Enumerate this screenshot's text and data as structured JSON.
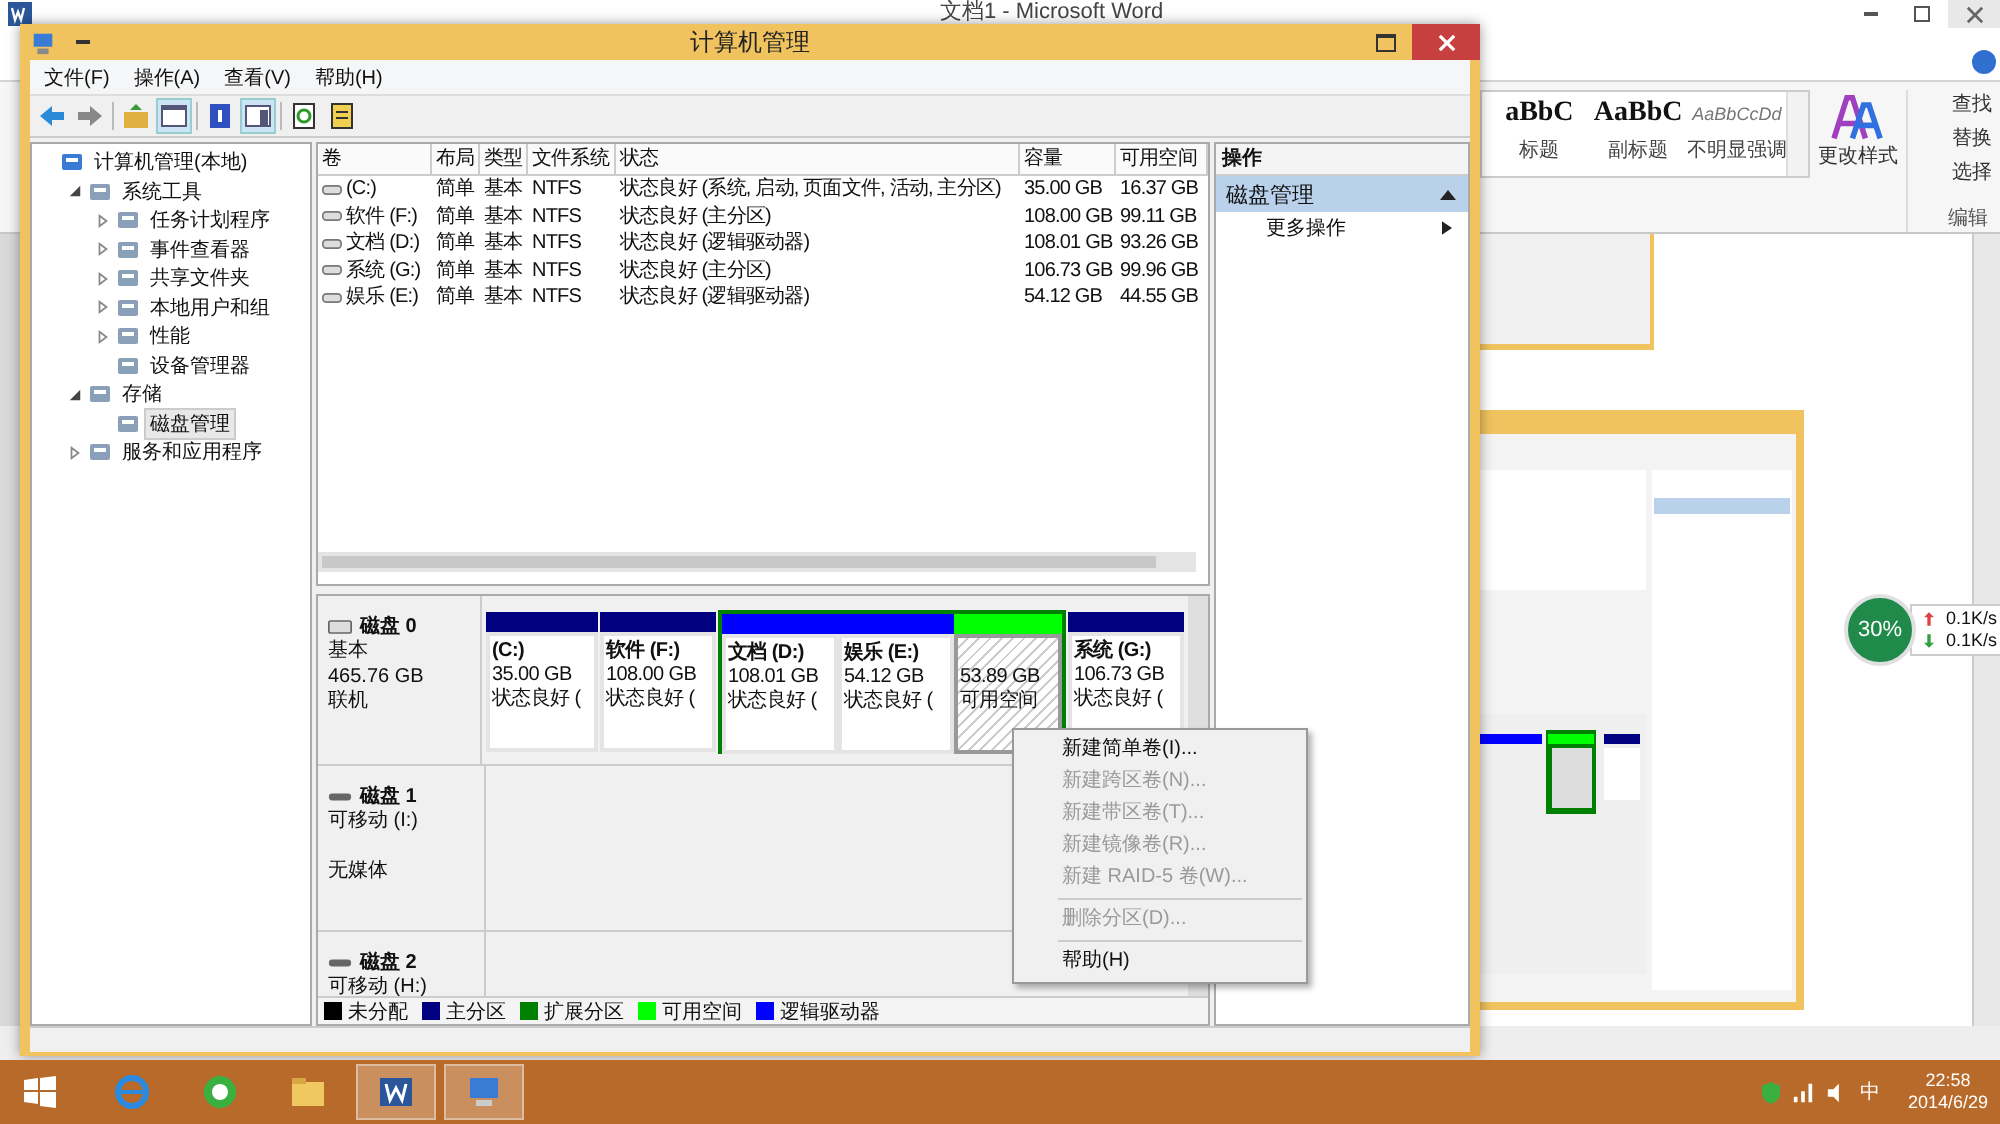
{
  "word": {
    "title": "文档1 - Microsoft Word",
    "styles": [
      {
        "sample": "aBbC",
        "label": "标题",
        "kind": "heading"
      },
      {
        "sample": "AaBbC",
        "label": "副标题",
        "kind": "heading"
      },
      {
        "sample": "AaBbCcDd",
        "label": "不明显强调",
        "kind": "emphasis"
      }
    ],
    "change_styles": "更改样式",
    "edit_buttons": [
      "查找",
      "替换",
      "选择"
    ],
    "edit_group": "编辑"
  },
  "window": {
    "title": "计算机管理"
  },
  "menu": [
    "文件(F)",
    "操作(A)",
    "查看(V)",
    "帮助(H)"
  ],
  "tree": [
    {
      "label": "计算机管理(本地)",
      "selected": false,
      "children": [
        {
          "label": "系统工具",
          "expanded": true,
          "selected": false,
          "children": [
            {
              "label": "任务计划程序",
              "expanded": false,
              "selected": false
            },
            {
              "label": "事件查看器",
              "expanded": false,
              "selected": false
            },
            {
              "label": "共享文件夹",
              "expanded": false,
              "selected": false
            },
            {
              "label": "本地用户和组",
              "expanded": false,
              "selected": false
            },
            {
              "label": "性能",
              "expanded": false,
              "selected": false
            },
            {
              "label": "设备管理器",
              "selected": false
            }
          ]
        },
        {
          "label": "存储",
          "expanded": true,
          "selected": false,
          "children": [
            {
              "label": "磁盘管理",
              "selected": true
            }
          ]
        },
        {
          "label": "服务和应用程序",
          "expanded": false,
          "selected": false
        }
      ]
    }
  ],
  "volumes": {
    "columns": [
      "卷",
      "布局",
      "类型",
      "文件系统",
      "状态",
      "容量",
      "可用空间"
    ],
    "rows": [
      [
        "(C:)",
        "简单",
        "基本",
        "NTFS",
        "状态良好 (系统, 启动, 页面文件, 活动, 主分区)",
        "35.00 GB",
        "16.37 GB"
      ],
      [
        "软件 (F:)",
        "简单",
        "基本",
        "NTFS",
        "状态良好 (主分区)",
        "108.00 GB",
        "99.11 GB"
      ],
      [
        "文档 (D:)",
        "简单",
        "基本",
        "NTFS",
        "状态良好 (逻辑驱动器)",
        "108.01 GB",
        "93.26 GB"
      ],
      [
        "系统 (G:)",
        "简单",
        "基本",
        "NTFS",
        "状态良好 (主分区)",
        "106.73 GB",
        "99.96 GB"
      ],
      [
        "娱乐 (E:)",
        "简单",
        "基本",
        "NTFS",
        "状态良好 (逻辑驱动器)",
        "54.12 GB",
        "44.55 GB"
      ]
    ]
  },
  "disks": [
    {
      "name": "磁盘 0",
      "kind": "fixed",
      "lines": [
        "基本",
        "465.76 GB",
        "联机"
      ],
      "partitions": [
        {
          "kind": "primary",
          "label": "(C:)",
          "size": "35.00 GB",
          "status": "状态良好 (",
          "selected": false
        },
        {
          "kind": "primary",
          "label": "软件  (F:)",
          "size": "108.00 GB",
          "status": "状态良好 (",
          "selected": false
        },
        {
          "kind": "extended",
          "children": [
            {
              "kind": "logical",
              "label": "文档  (D:)",
              "size": "108.01 GB",
              "status": "状态良好 (",
              "selected": false
            },
            {
              "kind": "logical",
              "label": "娱乐  (E:)",
              "size": "54.12 GB",
              "status": "状态良好 (",
              "selected": false
            },
            {
              "kind": "free",
              "size": "53.89 GB",
              "status": "可用空间",
              "selected": true
            }
          ]
        },
        {
          "kind": "primary",
          "label": "系统  (G:)",
          "size": "106.73 GB",
          "status": "状态良好 (",
          "selected": false
        }
      ]
    },
    {
      "name": "磁盘 1",
      "kind": "removable",
      "lines": [
        "可移动 (I:)",
        "无媒体"
      ]
    },
    {
      "name": "磁盘 2",
      "kind": "removable",
      "lines": [
        "可移动 (H:)"
      ]
    }
  ],
  "legend": [
    {
      "label": "未分配",
      "color": "#000000"
    },
    {
      "label": "主分区",
      "color": "#000080"
    },
    {
      "label": "扩展分区",
      "color": "#008000"
    },
    {
      "label": "可用空间",
      "color": "#00ff00"
    },
    {
      "label": "逻辑驱动器",
      "color": "#0000ff"
    }
  ],
  "actions": {
    "header": "操作",
    "section": "磁盘管理",
    "items": [
      "更多操作"
    ]
  },
  "context_menu": [
    {
      "kind": "item",
      "label": "新建简单卷(I)...",
      "disabled": false
    },
    {
      "kind": "item",
      "label": "新建跨区卷(N)...",
      "disabled": true
    },
    {
      "kind": "item",
      "label": "新建带区卷(T)...",
      "disabled": true
    },
    {
      "kind": "item",
      "label": "新建镜像卷(R)...",
      "disabled": true
    },
    {
      "kind": "item",
      "label": "新建 RAID-5 卷(W)...",
      "disabled": true
    },
    {
      "kind": "separator"
    },
    {
      "kind": "item",
      "label": "删除分区(D)...",
      "disabled": true
    },
    {
      "kind": "separator"
    },
    {
      "kind": "item",
      "label": "帮助(H)",
      "disabled": false
    }
  ],
  "meter": {
    "percent": "30%",
    "up": "0.1K/s",
    "down": "0.1K/s"
  },
  "taskbar": {
    "apps": [
      {
        "kind": "ie",
        "running": false
      },
      {
        "kind": "globe",
        "running": false
      },
      {
        "kind": "folder",
        "running": false
      },
      {
        "kind": "word",
        "running": true
      },
      {
        "kind": "manager",
        "running": true
      }
    ],
    "ime": "中",
    "time": "22:58",
    "date": "2014/6/29"
  }
}
